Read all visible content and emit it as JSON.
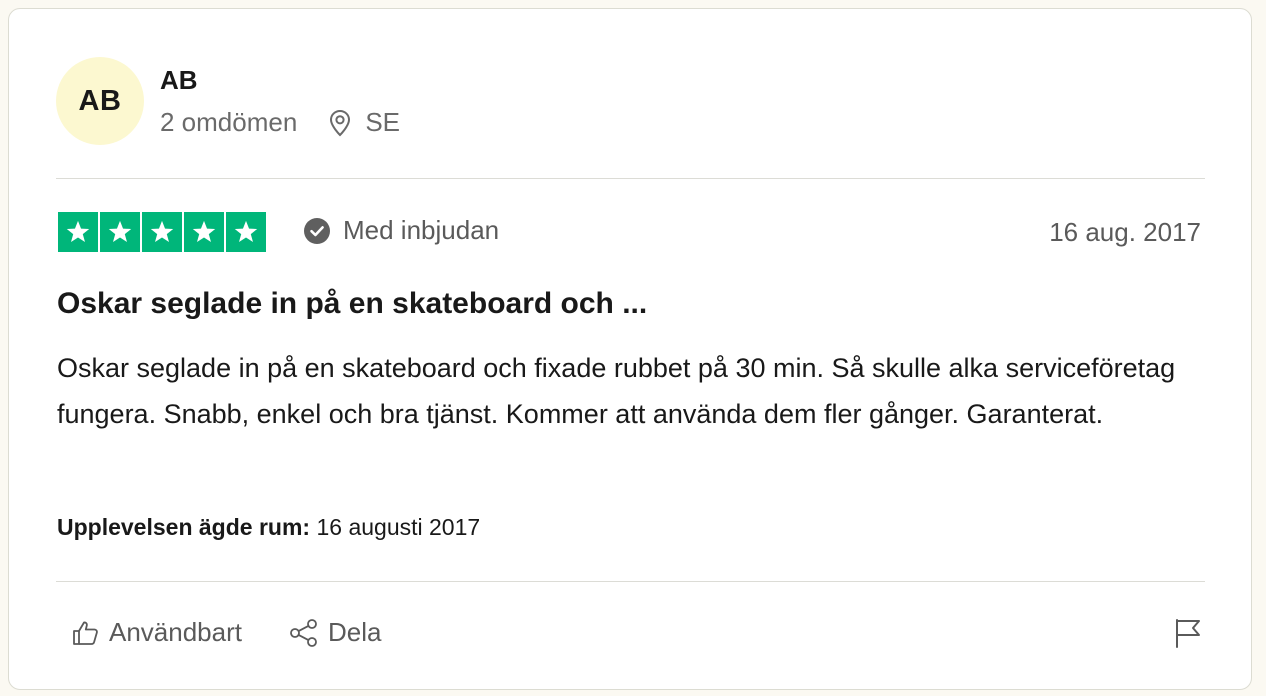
{
  "reviewer": {
    "initials": "AB",
    "name": "AB",
    "review_count": "2 omdömen",
    "location": "SE",
    "location_icon": "location-pin-icon"
  },
  "review": {
    "rating": 5,
    "rating_max": 5,
    "star_color": "#00b67a",
    "verified_label": "Med inbjudan",
    "verified_icon": "check-circle-icon",
    "date": "16 aug. 2017",
    "title": "Oskar seglade in på en skateboard och ...",
    "body": "Oskar seglade in på en skateboard och fixade rubbet på 30 min. Så skulle alka serviceföretag fungera. Snabb, enkel och bra tjänst. Kommer att använda dem fler gånger. Garanterat.",
    "experience_label": "Upplevelsen ägde rum:",
    "experience_date": "16 augusti 2017"
  },
  "actions": {
    "useful_label": "Användbart",
    "useful_icon": "thumbs-up-icon",
    "share_label": "Dela",
    "share_icon": "share-icon",
    "report_icon": "flag-icon"
  }
}
